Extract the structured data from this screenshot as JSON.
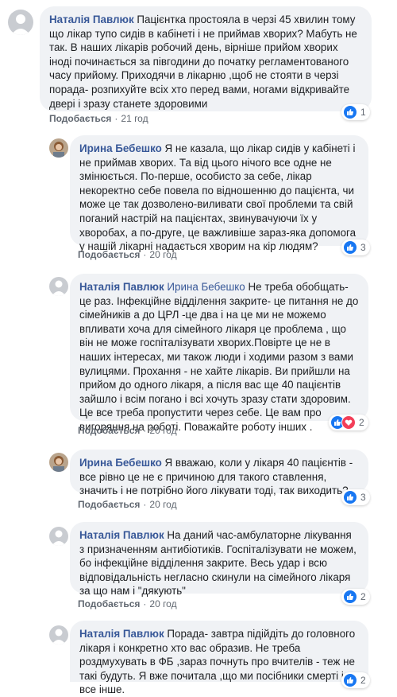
{
  "comments": [
    {
      "author": "Наталія Павлюк",
      "text": "Пацієнтка простояла в черзі 45 хвилин тому що лікар тупо сидів в кабінеті і не приймав хворих? Мабуть не так. В наших лікарів робочий день, вірніше прийом хворих іноді починається за півгодини до початку регламентованого часу прийому. Приходячи в лікарню ,щоб не стояти в черзі порада- розпихуйте всіх хто перед вами, ногами відкривайте двері і зразу станете здоровими",
      "like_label": "Подобається",
      "time": "21 год",
      "reaction_count": "1"
    },
    {
      "author": "Ирина Бебешко",
      "text": "Я не казала, що лікар сидів у кабінеті і не приймав хворих. Та від цього нічого все одне не змінюється. По-перше, особисто за себе, лікар некоректно себе повела по відношенню до пацієнта, чи може це так дозволено-виливати свої проблеми та свій поганий настрій на пацієнтах, звинувачуючи їх у хворобах, а по-друге, це важливіше зараз-яка допомога у нашій лікарні надається хворим на кір людям?",
      "like_label": "Подобається",
      "time": "20 год",
      "reaction_count": "3"
    },
    {
      "author": "Наталія Павлюк",
      "mention": "Ирина Бебешко",
      "text": "Не треба обобщать- це раз. Інфекційне відділення закрите- це питання не до сімейників а до ЦРЛ -це два і на це ми не можемо впливати хоча для сімейного лікаря це проблема , що він не може госпіталізувати хворих.Повірте це не в наших інтересах, ми також люди і ходими разом з вами вулицями. Прохання - не хайте лікарів. Ви прийшли на прийом до одного лікаря, а після вас ще 40 пацієнтів зайшло і всім погано і всі хочуть зразу стати здоровим. Це все треба пропустити через себе. Це вам про вигоряння на роботі. Поважайте роботу інших .",
      "like_label": "Подобається",
      "time": "20 год",
      "reaction_count": "2"
    },
    {
      "author": "Ирина Бебешко",
      "text": "Я вважаю, коли у лікаря 40 пацієнтів - все рівно це не є причиною для такого ставлення, значить і не потрібно його лікувати тоді, так виходить?",
      "like_label": "Подобається",
      "time": "20 год",
      "reaction_count": "3"
    },
    {
      "author": "Наталія Павлюк",
      "text": "На даний час-амбулаторне лікування з призначенням антибіотиків. Госпіталізувати не можем, бо інфекційне відділення закрите. Весь удар і всю відповідальність негласно скинули на сімейного лікаря за що нам і \"дякують\"",
      "like_label": "Подобається",
      "time": "20 год",
      "reaction_count": "2"
    },
    {
      "author": "Наталія Павлюк",
      "text": "Порада- завтра підійдіть до головного лікаря і конкретно хто вас образив. Не треба роздмухувать в ФБ ,зараз почнуть про вчителів - теж не такі будуть. Я вже почитала ,що ми посібники смерті і все інше.",
      "reaction_count": "2"
    }
  ],
  "colors": {
    "bubble": "#f0f2f5",
    "author": "#385898",
    "like": "#1877f2",
    "love": "#f33e58"
  }
}
